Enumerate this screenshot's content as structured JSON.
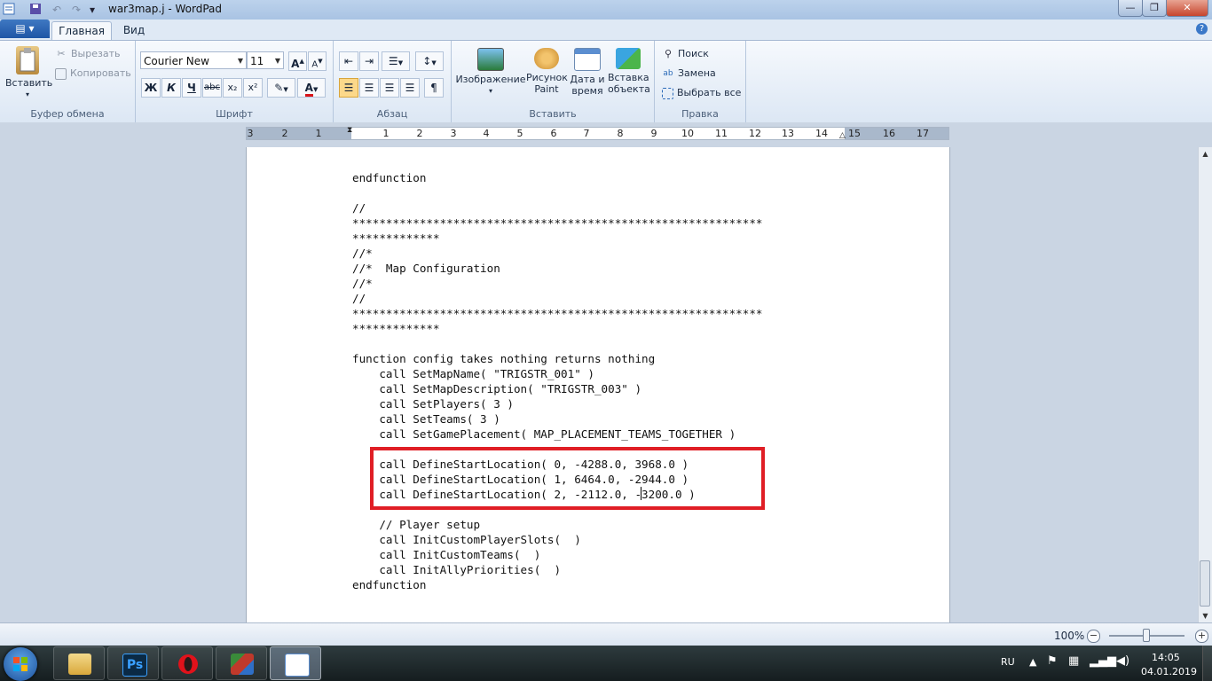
{
  "window": {
    "title": "war3map.j - WordPad",
    "minimize_glyph": "—",
    "maximize_glyph": "❐",
    "close_glyph": "✕"
  },
  "quick_access": {
    "save_icon": "save-icon",
    "undo_icon": "undo-icon",
    "redo_icon": "redo-icon",
    "customize_glyph": "▾"
  },
  "tabs": {
    "app_menu_glyph": "▤ ▾",
    "home": "Главная",
    "view": "Вид",
    "help_glyph": "?"
  },
  "ribbon": {
    "clipboard": {
      "label": "Буфер обмена",
      "paste": "Вставить",
      "paste_arrow": "▾",
      "cut": "Вырезать",
      "copy": "Копировать"
    },
    "font": {
      "label": "Шрифт",
      "family": "Courier New",
      "size": "11",
      "bold": "Ж",
      "italic": "К",
      "underline": "Ч",
      "strike": "abc",
      "subscript": "x₂",
      "superscript": "x²",
      "grow": "A",
      "shrink": "A",
      "highlight": "✎",
      "color": "A"
    },
    "paragraph": {
      "label": "Абзац"
    },
    "insert": {
      "label": "Вставить",
      "picture": "Изображение",
      "paint_1": "Рисунок",
      "paint_2": "Paint",
      "datetime_1": "Дата и",
      "datetime_2": "время",
      "object_1": "Вставка",
      "object_2": "объекта"
    },
    "editing": {
      "label": "Правка",
      "find": "Поиск",
      "replace": "Замена",
      "select_all": "Выбрать все"
    }
  },
  "ruler": {
    "numbers": [
      "3",
      "2",
      "1",
      "1",
      "2",
      "3",
      "4",
      "5",
      "6",
      "7",
      "8",
      "9",
      "10",
      "11",
      "12",
      "13",
      "14",
      "15",
      "16",
      "17"
    ]
  },
  "document": {
    "lines": [
      "endfunction",
      "",
      "//",
      "*************************************************************",
      "*************",
      "//*",
      "//*  Map Configuration",
      "//*",
      "//",
      "*************************************************************",
      "*************",
      "",
      "function config takes nothing returns nothing",
      "    call SetMapName( \"TRIGSTR_001\" )",
      "    call SetMapDescription( \"TRIGSTR_003\" )",
      "    call SetPlayers( 3 )",
      "    call SetTeams( 3 )",
      "    call SetGamePlacement( MAP_PLACEMENT_TEAMS_TOGETHER )",
      "",
      "    call DefineStartLocation( 0, -4288.0, 3968.0 )",
      "    call DefineStartLocation( 1, 6464.0, -2944.0 )",
      "    call DefineStartLocation( 2, -2112.0, -3200.0 )",
      "",
      "    // Player setup",
      "    call InitCustomPlayerSlots(  )",
      "    call InitCustomTeams(  )",
      "    call InitAllyPriorities(  )",
      "endfunction"
    ],
    "highlight_color": "#e01e25"
  },
  "scrollbar": {
    "up": "▲",
    "down": "▼"
  },
  "status": {
    "zoom": "100%",
    "zoom_minus": "−",
    "zoom_plus": "+"
  },
  "taskbar": {
    "apps": [
      "explorer-icon",
      "photoshop-icon",
      "opera-icon",
      "office-icon",
      "wordpad-icon"
    ],
    "ps_label": "Ps",
    "lang": "RU",
    "time": "14:05",
    "date": "04.01.2019"
  },
  "colors": {
    "accent": "#1e56a6",
    "ribbon_active": "#fcd88a",
    "highlight": "#e01e25"
  }
}
